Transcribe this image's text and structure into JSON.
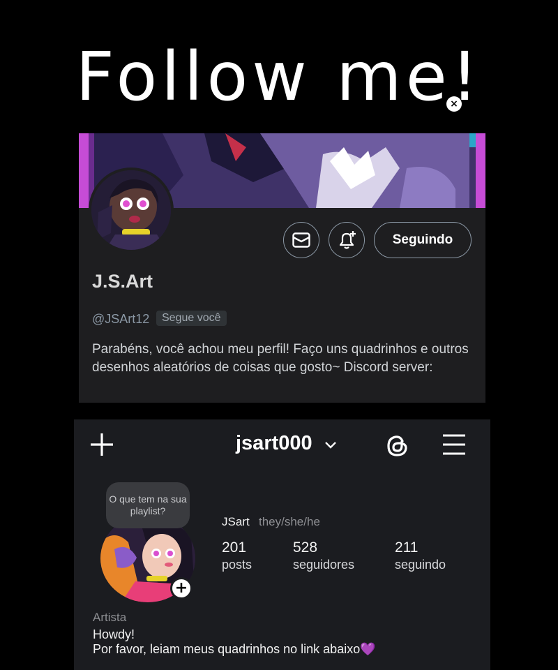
{
  "title": {
    "text": "Follow me!",
    "mark_icon": "x-mark-icon"
  },
  "twitter": {
    "display_name": "J.S.Art",
    "handle": "@JSArt12",
    "follows_you_badge": "Segue você",
    "following_button": "Seguindo",
    "bio": "Parabéns, você achou meu perfil! Faço uns quadrinhos e outros desenhos aleatórios de coisas que gosto~ Discord server:",
    "icons": [
      "mail-icon",
      "bell-plus-icon"
    ]
  },
  "instagram": {
    "username": "jsart000",
    "note_bubble": "O que tem na sua playlist?",
    "name": "JSart",
    "pronouns": "they/she/he",
    "stats": [
      {
        "value": "201",
        "label": "posts"
      },
      {
        "value": "528",
        "label": "seguidores"
      },
      {
        "value": "211",
        "label": "seguindo"
      }
    ],
    "category": "Artista",
    "bio_line1": "Howdy!",
    "bio_line2": "Por favor, leiam meus quadrinhos no link abaixo",
    "bio_emoji": "💜",
    "icons": [
      "plus-icon",
      "chevron-down-icon",
      "threads-icon",
      "menu-icon"
    ]
  },
  "colors": {
    "background": "#000000",
    "twitter_card": "#1e1e20",
    "instagram_card": "#1b1c20",
    "heart": "#9b51e0"
  }
}
